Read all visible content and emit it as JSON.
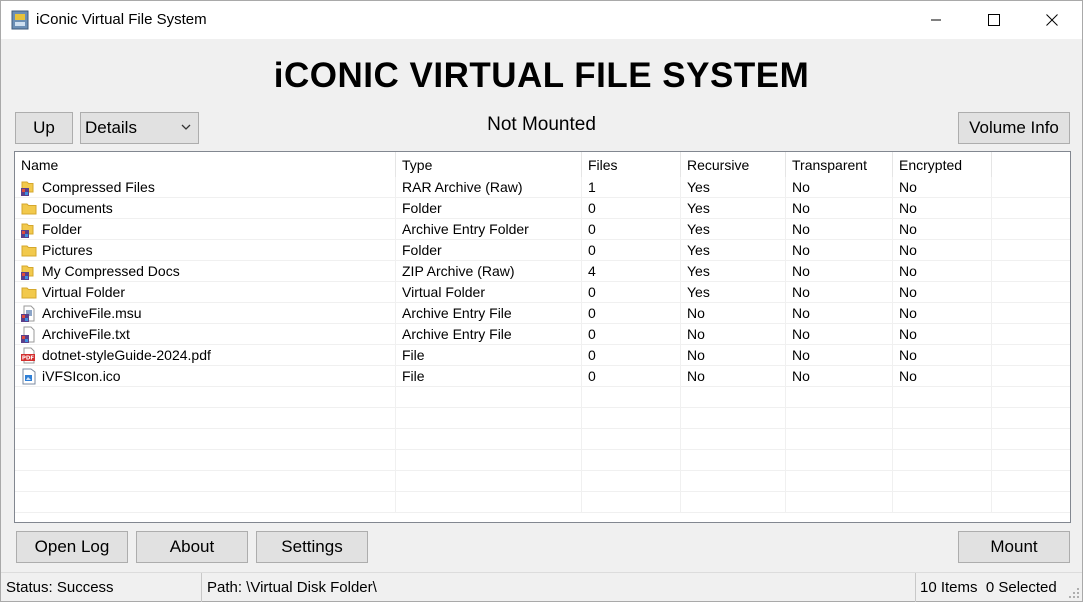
{
  "window": {
    "title": "iConic Virtual File System",
    "icon": "app-icon"
  },
  "heading": "iCONIC VIRTUAL FILE SYSTEM",
  "toolbar": {
    "up_label": "Up",
    "view_selected": "Details",
    "mount_status": "Not Mounted",
    "volume_info_label": "Volume Info"
  },
  "list": {
    "columns": [
      "Name",
      "Type",
      "Files",
      "Recursive",
      "Transparent",
      "Encrypted"
    ],
    "rows": [
      {
        "icon": "archive-folder-icon",
        "name": "Compressed Files",
        "type": "RAR Archive (Raw)",
        "files": "1",
        "recursive": "Yes",
        "transparent": "No",
        "encrypted": "No"
      },
      {
        "icon": "folder-icon",
        "name": "Documents",
        "type": "Folder",
        "files": "0",
        "recursive": "Yes",
        "transparent": "No",
        "encrypted": "No"
      },
      {
        "icon": "archive-folder-icon",
        "name": "Folder",
        "type": "Archive Entry Folder",
        "files": "0",
        "recursive": "Yes",
        "transparent": "No",
        "encrypted": "No"
      },
      {
        "icon": "folder-icon",
        "name": "Pictures",
        "type": "Folder",
        "files": "0",
        "recursive": "Yes",
        "transparent": "No",
        "encrypted": "No"
      },
      {
        "icon": "archive-folder-icon",
        "name": "My Compressed Docs",
        "type": "ZIP Archive (Raw)",
        "files": "4",
        "recursive": "Yes",
        "transparent": "No",
        "encrypted": "No"
      },
      {
        "icon": "folder-icon",
        "name": "Virtual Folder",
        "type": "Virtual Folder",
        "files": "0",
        "recursive": "Yes",
        "transparent": "No",
        "encrypted": "No"
      },
      {
        "icon": "installer-file-icon",
        "name": "ArchiveFile.msu",
        "type": "Archive Entry File",
        "files": "0",
        "recursive": "No",
        "transparent": "No",
        "encrypted": "No"
      },
      {
        "icon": "archive-file-icon",
        "name": "ArchiveFile.txt",
        "type": "Archive Entry File",
        "files": "0",
        "recursive": "No",
        "transparent": "No",
        "encrypted": "No"
      },
      {
        "icon": "pdf-file-icon",
        "name": "dotnet-styleGuide-2024.pdf",
        "type": "File",
        "files": "0",
        "recursive": "No",
        "transparent": "No",
        "encrypted": "No"
      },
      {
        "icon": "image-file-icon",
        "name": "iVFSIcon.ico",
        "type": "File",
        "files": "0",
        "recursive": "No",
        "transparent": "No",
        "encrypted": "No"
      }
    ]
  },
  "bottom_buttons": {
    "open_log": "Open Log",
    "about": "About",
    "settings": "Settings",
    "mount": "Mount"
  },
  "statusbar": {
    "status": "Status: Success",
    "path": "Path: \\Virtual Disk Folder\\",
    "items": "10 Items  0 Selected"
  },
  "colors": {
    "folder": "#f2c94c",
    "window_bg": "#f0f0f0",
    "button_bg": "#e1e1e1",
    "pdf_red": "#d32f2f"
  }
}
